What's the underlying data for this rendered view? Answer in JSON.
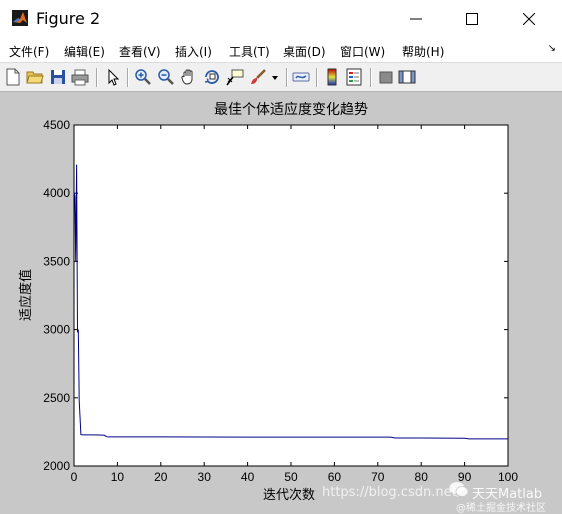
{
  "window": {
    "title": "Figure 2"
  },
  "menu": [
    "文件(F)",
    "编辑(E)",
    "查看(V)",
    "插入(I)",
    "工具(T)",
    "桌面(D)",
    "窗口(W)",
    "帮助(H)"
  ],
  "toolbar_icons": [
    "new-figure-icon",
    "open-file-icon",
    "save-icon",
    "print-icon",
    "edit-plot-arrow-icon",
    "zoom-in-icon",
    "zoom-out-icon",
    "pan-hand-icon",
    "rotate-3d-icon",
    "data-cursor-icon",
    "brush-icon",
    "link-plot-icon",
    "insert-colorbar-icon",
    "insert-legend-icon",
    "hide-plot-tools-icon",
    "show-plot-tools-icon"
  ],
  "chart_data": {
    "type": "line",
    "title": "最佳个体适应度变化趋势",
    "xlabel": "迭代次数",
    "ylabel": "适应度值",
    "xlim": [
      0,
      100
    ],
    "ylim": [
      2000,
      4500
    ],
    "xticks": [
      0,
      10,
      20,
      30,
      40,
      50,
      60,
      70,
      80,
      90,
      100
    ],
    "yticks": [
      2000,
      2500,
      3000,
      3500,
      4000,
      4500
    ],
    "line_color": "#00008b",
    "grid": false,
    "series": [
      {
        "x": [
          0,
          0.2,
          0.4,
          0.6,
          0.8,
          1,
          1.2,
          1.6,
          2,
          4,
          6,
          7,
          7.5,
          8,
          20,
          40,
          60,
          73,
          74,
          80,
          90,
          91,
          92,
          100
        ],
        "y": [
          4000,
          3980,
          3500,
          4210,
          2980,
          3000,
          2480,
          2230,
          2228,
          2228,
          2227,
          2225,
          2215,
          2213,
          2213,
          2212,
          2212,
          2212,
          2205,
          2205,
          2204,
          2199,
          2199,
          2199
        ]
      }
    ]
  },
  "watermark": {
    "url": "https://blog.csdn.net/",
    "account": "天天Matlab",
    "community": "@稀土掘金技术社区"
  }
}
